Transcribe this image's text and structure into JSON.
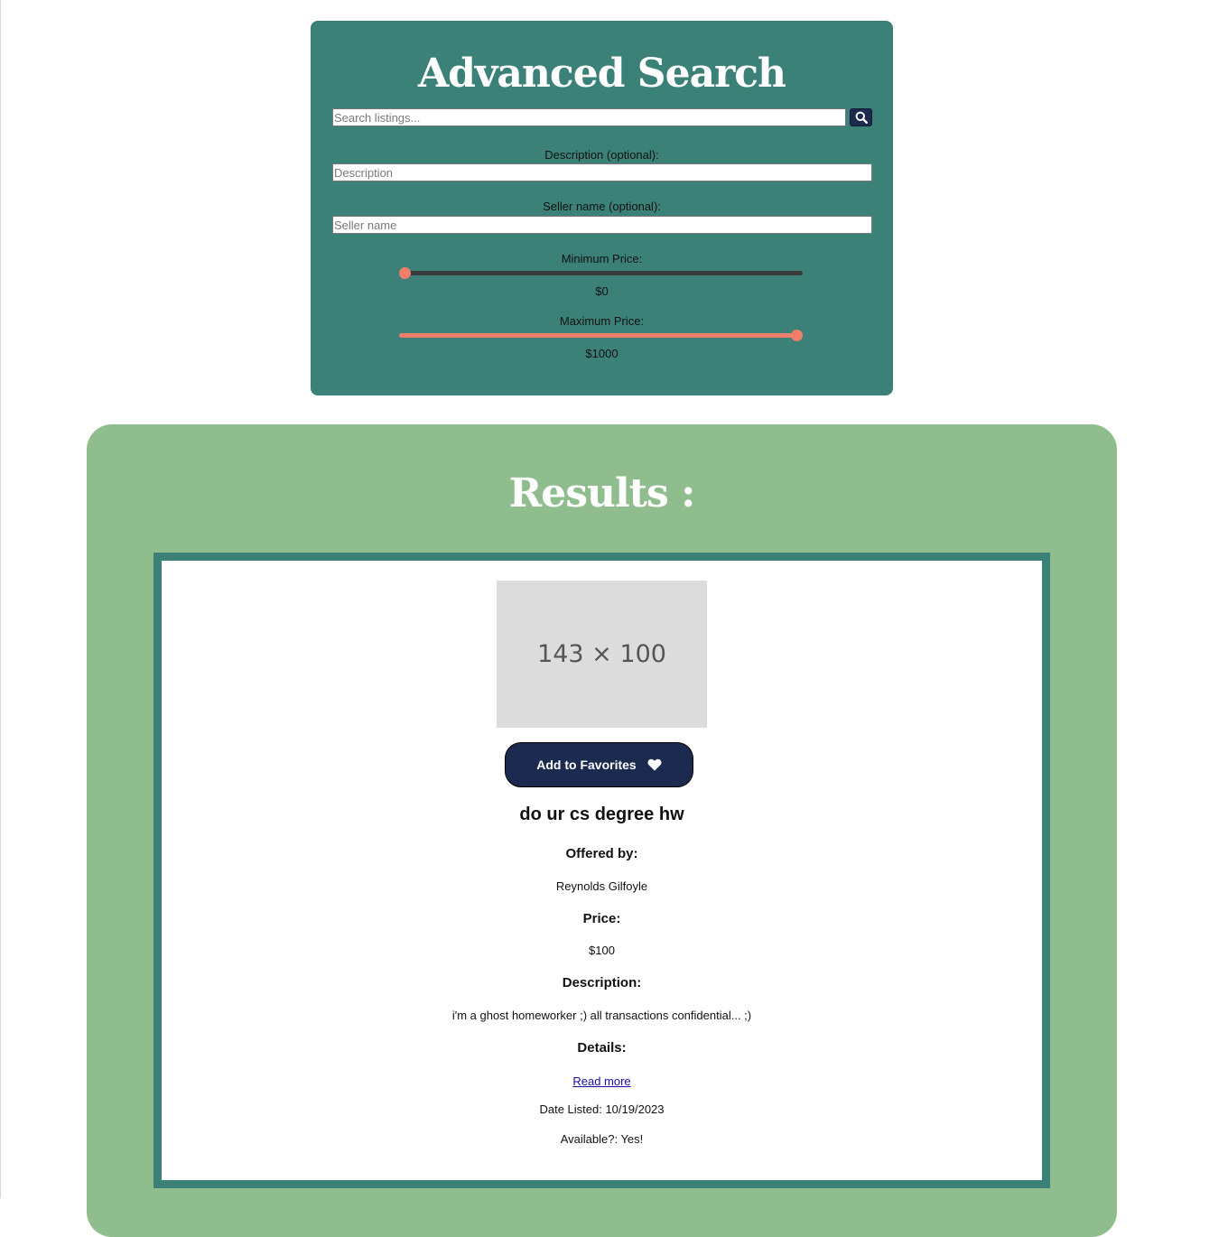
{
  "search": {
    "title": "Advanced Search",
    "placeholder": "Search listings...",
    "search_button_icon": "search-icon",
    "description_label": "Description (optional):",
    "description_placeholder": "Description",
    "seller_label": "Seller name (optional):",
    "seller_placeholder": "Seller name",
    "min_price_label": "Minimum Price:",
    "min_price_value": "$0",
    "min_price": 0,
    "max_price_label": "Maximum Price:",
    "max_price_value": "$1000",
    "max_price": 1000,
    "price_range": [
      0,
      1000
    ],
    "colors": {
      "panel": "#3b8177",
      "slider_thumb": "#f07e69",
      "button": "#1b2a4e"
    }
  },
  "results": {
    "title": "Results :",
    "colors": {
      "panel": "#8fbd8d",
      "card_border": "#3b8177"
    },
    "listings": [
      {
        "image_placeholder": "143 × 100",
        "favorite_label": "Add to Favorites",
        "favorite_icon": "heart-icon",
        "title": "do ur cs degree hw",
        "offered_by_label": "Offered by:",
        "seller": "Reynolds Gilfoyle",
        "price_label": "Price:",
        "price": "$100",
        "description_label": "Description:",
        "description": "i'm a ghost homeworker ;) all transactions confidential... ;)",
        "details_label": "Details:",
        "read_more": "Read more",
        "date_listed": "Date Listed: 10/19/2023",
        "available": "Available?: Yes!"
      }
    ]
  }
}
